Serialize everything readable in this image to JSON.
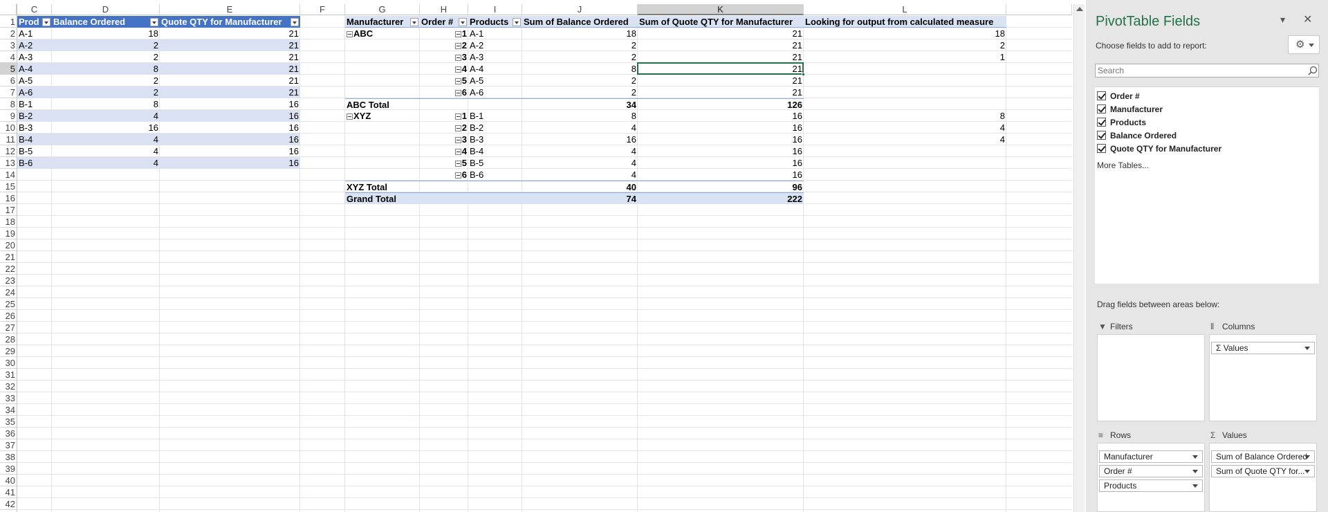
{
  "sheet": {
    "columns": [
      {
        "id": "C",
        "selected": false
      },
      {
        "id": "D",
        "selected": false
      },
      {
        "id": "E",
        "selected": false
      },
      {
        "id": "F",
        "selected": false
      },
      {
        "id": "G",
        "selected": false
      },
      {
        "id": "H",
        "selected": false
      },
      {
        "id": "I",
        "selected": false
      },
      {
        "id": "J",
        "selected": false
      },
      {
        "id": "K",
        "selected": true
      },
      {
        "id": "L",
        "selected": false
      }
    ],
    "row_numbers": [
      "1",
      "2",
      "3",
      "4",
      "5",
      "6",
      "7",
      "8",
      "9",
      "10",
      "11",
      "12",
      "13",
      "14",
      "15",
      "16",
      "17",
      "18",
      "19",
      "20",
      "21",
      "22",
      "23",
      "24",
      "25",
      "26",
      "27",
      "28",
      "29",
      "30",
      "31",
      "32",
      "33",
      "34",
      "35",
      "36",
      "37",
      "38",
      "39",
      "40",
      "41",
      "42"
    ],
    "selected_row": "5",
    "active_cell": "K5"
  },
  "source_table": {
    "headers": [
      "Prod",
      "Balance Ordered",
      "Quote QTY for Manufacturer"
    ],
    "rows": [
      [
        "A-1",
        "18",
        "21"
      ],
      [
        "A-2",
        "2",
        "21"
      ],
      [
        "A-3",
        "2",
        "21"
      ],
      [
        "A-4",
        "8",
        "21"
      ],
      [
        "A-5",
        "2",
        "21"
      ],
      [
        "A-6",
        "2",
        "21"
      ],
      [
        "B-1",
        "8",
        "16"
      ],
      [
        "B-2",
        "4",
        "16"
      ],
      [
        "B-3",
        "16",
        "16"
      ],
      [
        "B-4",
        "4",
        "16"
      ],
      [
        "B-5",
        "4",
        "16"
      ],
      [
        "B-6",
        "4",
        "16"
      ]
    ]
  },
  "pivot": {
    "headers": [
      "Manufacturer",
      "Order #",
      "Products",
      "Sum of Balance Ordered",
      "Sum of Quote QTY for Manufacturer",
      "Looking for output from calculated measure"
    ],
    "groups": [
      {
        "name": "ABC",
        "rows": [
          {
            "order": "1",
            "product": "A-1",
            "balance": "18",
            "quote": "21",
            "output": "18"
          },
          {
            "order": "2",
            "product": "A-2",
            "balance": "2",
            "quote": "21",
            "output": "2"
          },
          {
            "order": "3",
            "product": "A-3",
            "balance": "2",
            "quote": "21",
            "output": "1"
          },
          {
            "order": "4",
            "product": "A-4",
            "balance": "8",
            "quote": "21",
            "output": ""
          },
          {
            "order": "5",
            "product": "A-5",
            "balance": "2",
            "quote": "21",
            "output": ""
          },
          {
            "order": "6",
            "product": "A-6",
            "balance": "2",
            "quote": "21",
            "output": ""
          }
        ],
        "total_label": "ABC Total",
        "total_balance": "34",
        "total_quote": "126"
      },
      {
        "name": "XYZ",
        "rows": [
          {
            "order": "1",
            "product": "B-1",
            "balance": "8",
            "quote": "16",
            "output": "8"
          },
          {
            "order": "2",
            "product": "B-2",
            "balance": "4",
            "quote": "16",
            "output": "4"
          },
          {
            "order": "3",
            "product": "B-3",
            "balance": "16",
            "quote": "16",
            "output": "4"
          },
          {
            "order": "4",
            "product": "B-4",
            "balance": "4",
            "quote": "16",
            "output": ""
          },
          {
            "order": "5",
            "product": "B-5",
            "balance": "4",
            "quote": "16",
            "output": ""
          },
          {
            "order": "6",
            "product": "B-6",
            "balance": "4",
            "quote": "16",
            "output": ""
          }
        ],
        "total_label": "XYZ Total",
        "total_balance": "40",
        "total_quote": "96"
      }
    ],
    "grand_total_label": "Grand Total",
    "grand_total_balance": "74",
    "grand_total_quote": "222"
  },
  "panel": {
    "title": "PivotTable Fields",
    "choose_label": "Choose fields to add to report:",
    "search_placeholder": "Search",
    "fields": [
      "Order #",
      "Manufacturer",
      "Products",
      "Balance Ordered",
      "Quote QTY for Manufacturer"
    ],
    "more_tables": "More Tables...",
    "drag_text": "Drag fields between areas below:",
    "filters_label": "Filters",
    "columns_label": "Columns",
    "rows_label": "Rows",
    "values_label": "Values",
    "columns_items": [
      "Values"
    ],
    "rows_items": [
      "Manufacturer",
      "Order #",
      "Products"
    ],
    "values_items": [
      "Sum of Balance Ordered",
      "Sum of Quote QTY for..."
    ],
    "icons": [
      "dropdown-icon",
      "close-icon",
      "gear-icon",
      "search-icon",
      "filter-icon",
      "columns-icon",
      "rows-icon",
      "sigma-icon"
    ],
    "accent_color": "#217346"
  }
}
